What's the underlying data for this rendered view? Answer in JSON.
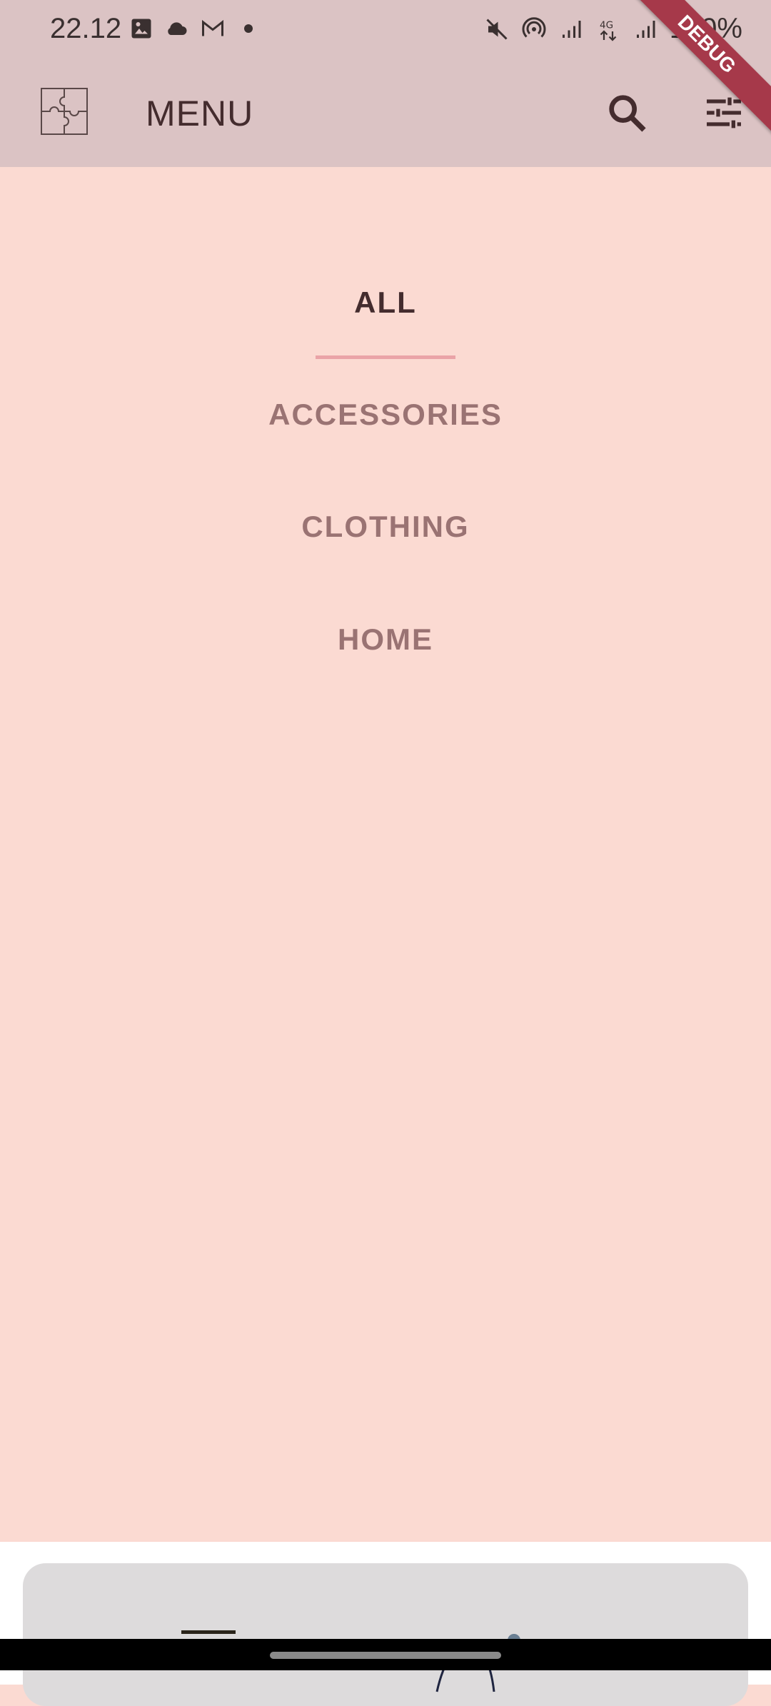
{
  "status_bar": {
    "time": "22.12",
    "battery": "100%",
    "icons": [
      "gallery-icon",
      "cloud-icon",
      "gmail-icon",
      "dot-icon",
      "mute-icon",
      "hotspot-icon",
      "signal-icon",
      "4g-icon",
      "signal-icon"
    ]
  },
  "app_bar": {
    "title": "MENU",
    "logo_icon": "puzzle-icon",
    "search_icon": "search-icon",
    "filter_icon": "tune-icon"
  },
  "debug_banner": "DEBUG",
  "categories": [
    {
      "label": "ALL",
      "active": true
    },
    {
      "label": "ACCESSORIES",
      "active": false
    },
    {
      "label": "CLOTHING",
      "active": false
    },
    {
      "label": "HOME",
      "active": false
    }
  ],
  "colors": {
    "background": "#fbdad2",
    "app_bar": "#dbc3c4",
    "active_text": "#442c2e",
    "inactive_text": "#9a7373",
    "underline": "#eaa3a7",
    "debug_ribbon": "#a6394a"
  }
}
